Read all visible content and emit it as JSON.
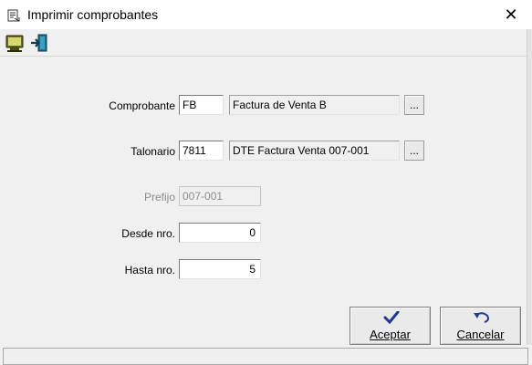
{
  "window": {
    "title": "Imprimir comprobantes",
    "close_glyph": "✕"
  },
  "toolbar": {
    "buttons": [
      {
        "name": "monitor-icon",
        "tooltip": ""
      },
      {
        "name": "exit-door-icon",
        "tooltip": ""
      }
    ]
  },
  "form": {
    "comprobante": {
      "label": "Comprobante",
      "code": "FB",
      "description": "Factura de Venta B",
      "browse": "..."
    },
    "talonario": {
      "label": "Talonario",
      "code": "7811",
      "description": "DTE Factura Venta 007-001",
      "browse": "..."
    },
    "prefijo": {
      "label": "Prefijo",
      "value": "007-001"
    },
    "desde": {
      "label": "Desde nro.",
      "value": "0"
    },
    "hasta": {
      "label": "Hasta nro.",
      "value": "5"
    }
  },
  "actions": {
    "accept_label": "Aceptar",
    "cancel_label": "Cancelar"
  },
  "colors": {
    "accept_icon": "#1f3a93",
    "cancel_icon": "#1f3a93"
  }
}
